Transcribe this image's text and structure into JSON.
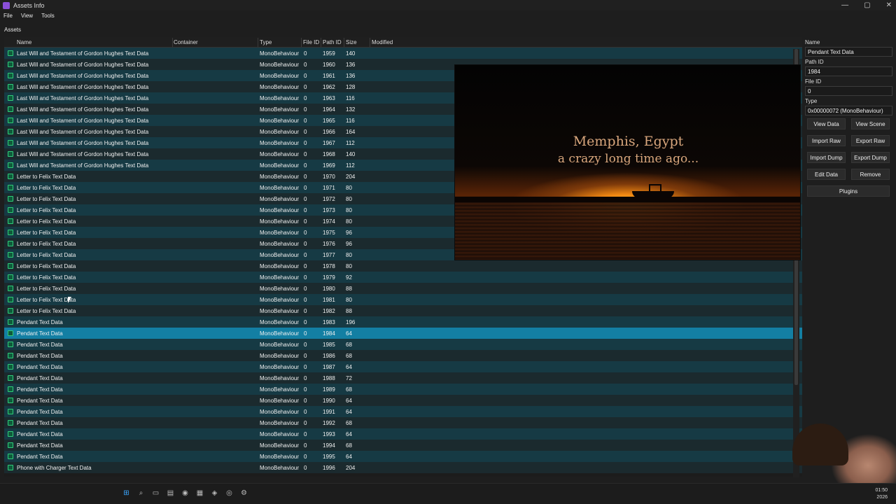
{
  "window": {
    "title": "Assets Info",
    "controls": [
      "—",
      "▢",
      "✕"
    ]
  },
  "menu": [
    "File",
    "View",
    "Tools"
  ],
  "assets_label": "Assets",
  "columns": {
    "name": "Name",
    "container": "Container",
    "type": "Type",
    "file_id": "File ID",
    "path_id": "Path ID",
    "size": "Size",
    "modified": "Modified"
  },
  "rows": [
    {
      "name": "Last Will and Testament of Gordon Hughes Text Data",
      "type": "MonoBehaviour",
      "file_id": "0",
      "path_id": "1959",
      "size": "140"
    },
    {
      "name": "Last Will and Testament of Gordon Hughes Text Data",
      "type": "MonoBehaviour",
      "file_id": "0",
      "path_id": "1960",
      "size": "136"
    },
    {
      "name": "Last Will and Testament of Gordon Hughes Text Data",
      "type": "MonoBehaviour",
      "file_id": "0",
      "path_id": "1961",
      "size": "136"
    },
    {
      "name": "Last Will and Testament of Gordon Hughes Text Data",
      "type": "MonoBehaviour",
      "file_id": "0",
      "path_id": "1962",
      "size": "128"
    },
    {
      "name": "Last Will and Testament of Gordon Hughes Text Data",
      "type": "MonoBehaviour",
      "file_id": "0",
      "path_id": "1963",
      "size": "116"
    },
    {
      "name": "Last Will and Testament of Gordon Hughes Text Data",
      "type": "MonoBehaviour",
      "file_id": "0",
      "path_id": "1964",
      "size": "132"
    },
    {
      "name": "Last Will and Testament of Gordon Hughes Text Data",
      "type": "MonoBehaviour",
      "file_id": "0",
      "path_id": "1965",
      "size": "116"
    },
    {
      "name": "Last Will and Testament of Gordon Hughes Text Data",
      "type": "MonoBehaviour",
      "file_id": "0",
      "path_id": "1966",
      "size": "164"
    },
    {
      "name": "Last Will and Testament of Gordon Hughes Text Data",
      "type": "MonoBehaviour",
      "file_id": "0",
      "path_id": "1967",
      "size": "112"
    },
    {
      "name": "Last Will and Testament of Gordon Hughes Text Data",
      "type": "MonoBehaviour",
      "file_id": "0",
      "path_id": "1968",
      "size": "140"
    },
    {
      "name": "Last Will and Testament of Gordon Hughes Text Data",
      "type": "MonoBehaviour",
      "file_id": "0",
      "path_id": "1969",
      "size": "112"
    },
    {
      "name": "Letter to Felix Text Data",
      "type": "MonoBehaviour",
      "file_id": "0",
      "path_id": "1970",
      "size": "204"
    },
    {
      "name": "Letter to Felix Text Data",
      "type": "MonoBehaviour",
      "file_id": "0",
      "path_id": "1971",
      "size": "80"
    },
    {
      "name": "Letter to Felix Text Data",
      "type": "MonoBehaviour",
      "file_id": "0",
      "path_id": "1972",
      "size": "80"
    },
    {
      "name": "Letter to Felix Text Data",
      "type": "MonoBehaviour",
      "file_id": "0",
      "path_id": "1973",
      "size": "80"
    },
    {
      "name": "Letter to Felix Text Data",
      "type": "MonoBehaviour",
      "file_id": "0",
      "path_id": "1974",
      "size": "80"
    },
    {
      "name": "Letter to Felix Text Data",
      "type": "MonoBehaviour",
      "file_id": "0",
      "path_id": "1975",
      "size": "96"
    },
    {
      "name": "Letter to Felix Text Data",
      "type": "MonoBehaviour",
      "file_id": "0",
      "path_id": "1976",
      "size": "96"
    },
    {
      "name": "Letter to Felix Text Data",
      "type": "MonoBehaviour",
      "file_id": "0",
      "path_id": "1977",
      "size": "80"
    },
    {
      "name": "Letter to Felix Text Data",
      "type": "MonoBehaviour",
      "file_id": "0",
      "path_id": "1978",
      "size": "80"
    },
    {
      "name": "Letter to Felix Text Data",
      "type": "MonoBehaviour",
      "file_id": "0",
      "path_id": "1979",
      "size": "92"
    },
    {
      "name": "Letter to Felix Text Data",
      "type": "MonoBehaviour",
      "file_id": "0",
      "path_id": "1980",
      "size": "88"
    },
    {
      "name": "Letter to Felix Text Data",
      "type": "MonoBehaviour",
      "file_id": "0",
      "path_id": "1981",
      "size": "80"
    },
    {
      "name": "Letter to Felix Text Data",
      "type": "MonoBehaviour",
      "file_id": "0",
      "path_id": "1982",
      "size": "88"
    },
    {
      "name": "Pendant Text Data",
      "type": "MonoBehaviour",
      "file_id": "0",
      "path_id": "1983",
      "size": "196"
    },
    {
      "name": "Pendant Text Data",
      "type": "MonoBehaviour",
      "file_id": "0",
      "path_id": "1984",
      "size": "64",
      "selected": true
    },
    {
      "name": "Pendant Text Data",
      "type": "MonoBehaviour",
      "file_id": "0",
      "path_id": "1985",
      "size": "68"
    },
    {
      "name": "Pendant Text Data",
      "type": "MonoBehaviour",
      "file_id": "0",
      "path_id": "1986",
      "size": "68"
    },
    {
      "name": "Pendant Text Data",
      "type": "MonoBehaviour",
      "file_id": "0",
      "path_id": "1987",
      "size": "64"
    },
    {
      "name": "Pendant Text Data",
      "type": "MonoBehaviour",
      "file_id": "0",
      "path_id": "1988",
      "size": "72"
    },
    {
      "name": "Pendant Text Data",
      "type": "MonoBehaviour",
      "file_id": "0",
      "path_id": "1989",
      "size": "68"
    },
    {
      "name": "Pendant Text Data",
      "type": "MonoBehaviour",
      "file_id": "0",
      "path_id": "1990",
      "size": "64"
    },
    {
      "name": "Pendant Text Data",
      "type": "MonoBehaviour",
      "file_id": "0",
      "path_id": "1991",
      "size": "64"
    },
    {
      "name": "Pendant Text Data",
      "type": "MonoBehaviour",
      "file_id": "0",
      "path_id": "1992",
      "size": "68"
    },
    {
      "name": "Pendant Text Data",
      "type": "MonoBehaviour",
      "file_id": "0",
      "path_id": "1993",
      "size": "64"
    },
    {
      "name": "Pendant Text Data",
      "type": "MonoBehaviour",
      "file_id": "0",
      "path_id": "1994",
      "size": "68"
    },
    {
      "name": "Pendant Text Data",
      "type": "MonoBehaviour",
      "file_id": "0",
      "path_id": "1995",
      "size": "64"
    },
    {
      "name": "Phone with Charger Text Data",
      "type": "MonoBehaviour",
      "file_id": "0",
      "path_id": "1996",
      "size": "204"
    }
  ],
  "preview": {
    "line1": "Memphis, Egypt",
    "line2": "a crazy long time ago..."
  },
  "side": {
    "name_label": "Name",
    "name_value": "Pendant Text Data",
    "path_label": "Path ID",
    "path_value": "1984",
    "file_label": "File ID",
    "file_value": "0",
    "type_label": "Type",
    "type_value": "0x00000072 (MonoBehaviour)",
    "buttons": {
      "view_data": "View Data",
      "view_scene": "View Scene",
      "import_raw": "Import Raw",
      "export_raw": "Export Raw",
      "import_dump": "Import Dump",
      "export_dump": "Export Dump",
      "edit_data": "Edit Data",
      "remove": "Remove",
      "plugins": "Plugins"
    }
  },
  "taskbar": {
    "icons": [
      "windows-start-icon",
      "search-icon",
      "task-view-icon",
      "explorer-icon",
      "edge-icon",
      "store-icon",
      "vscode-icon",
      "chrome-icon",
      "settings-icon"
    ],
    "clock_time": "01:50",
    "clock_date": "2026"
  },
  "colors": {
    "row_odd": "#163a44",
    "row_even": "#1b2a2e",
    "selected": "#137fa3",
    "accent_icon": "#2fce7a"
  }
}
